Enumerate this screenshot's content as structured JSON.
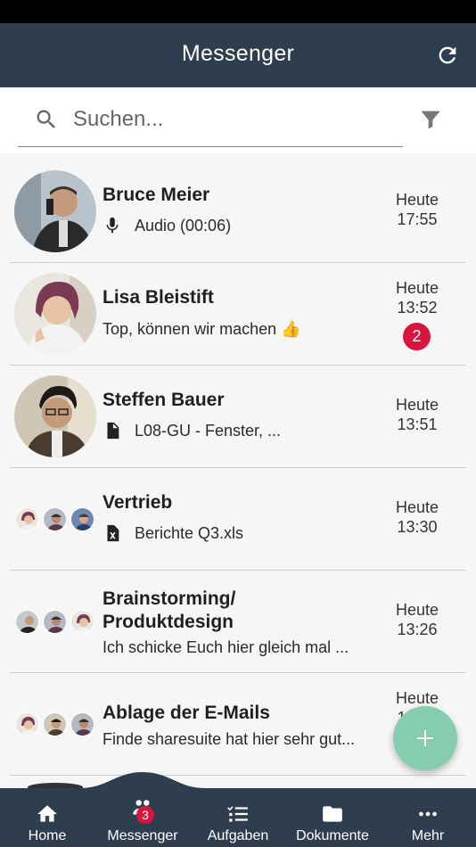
{
  "appbar": {
    "title": "Messenger"
  },
  "search": {
    "placeholder": "Suchen..."
  },
  "chats": [
    {
      "name": "Bruce Meier",
      "preview": "Audio (00:06)",
      "preview_icon": "microphone-icon",
      "day": "Heute",
      "time": "17:55"
    },
    {
      "name": "Lisa Bleistift",
      "preview": "Top, können wir machen 👍",
      "day": "Heute",
      "time": "13:52",
      "unread": "2"
    },
    {
      "name": "Steffen Bauer",
      "preview": "L08-GU - Fenster, ...",
      "preview_icon": "document-icon",
      "day": "Heute",
      "time": "13:51"
    },
    {
      "name": "Vertrieb",
      "preview": "Berichte Q3.xls",
      "preview_icon": "excel-file-icon",
      "day": "Heute",
      "time": "13:30"
    },
    {
      "name": "Brainstorming/",
      "name2": "Produktdesign",
      "preview": "Ich schicke Euch hier gleich mal ...",
      "day": "Heute",
      "time": "13:26"
    },
    {
      "name": "Ablage der E-Mails",
      "preview": "Finde sharesuite hat hier sehr gut...",
      "day": "Heute",
      "time": "13:25"
    }
  ],
  "nav": [
    {
      "label": "Home",
      "icon": "home-icon"
    },
    {
      "label": "Messenger",
      "icon": "people-icon",
      "badge": "3"
    },
    {
      "label": "Aufgaben",
      "icon": "checklist-icon"
    },
    {
      "label": "Dokumente",
      "icon": "folder-icon"
    },
    {
      "label": "Mehr",
      "icon": "more-dots-icon"
    }
  ],
  "colors": {
    "appbar": "#2f3e4e",
    "badge": "#d8153f",
    "fab": "#86cdb0"
  }
}
